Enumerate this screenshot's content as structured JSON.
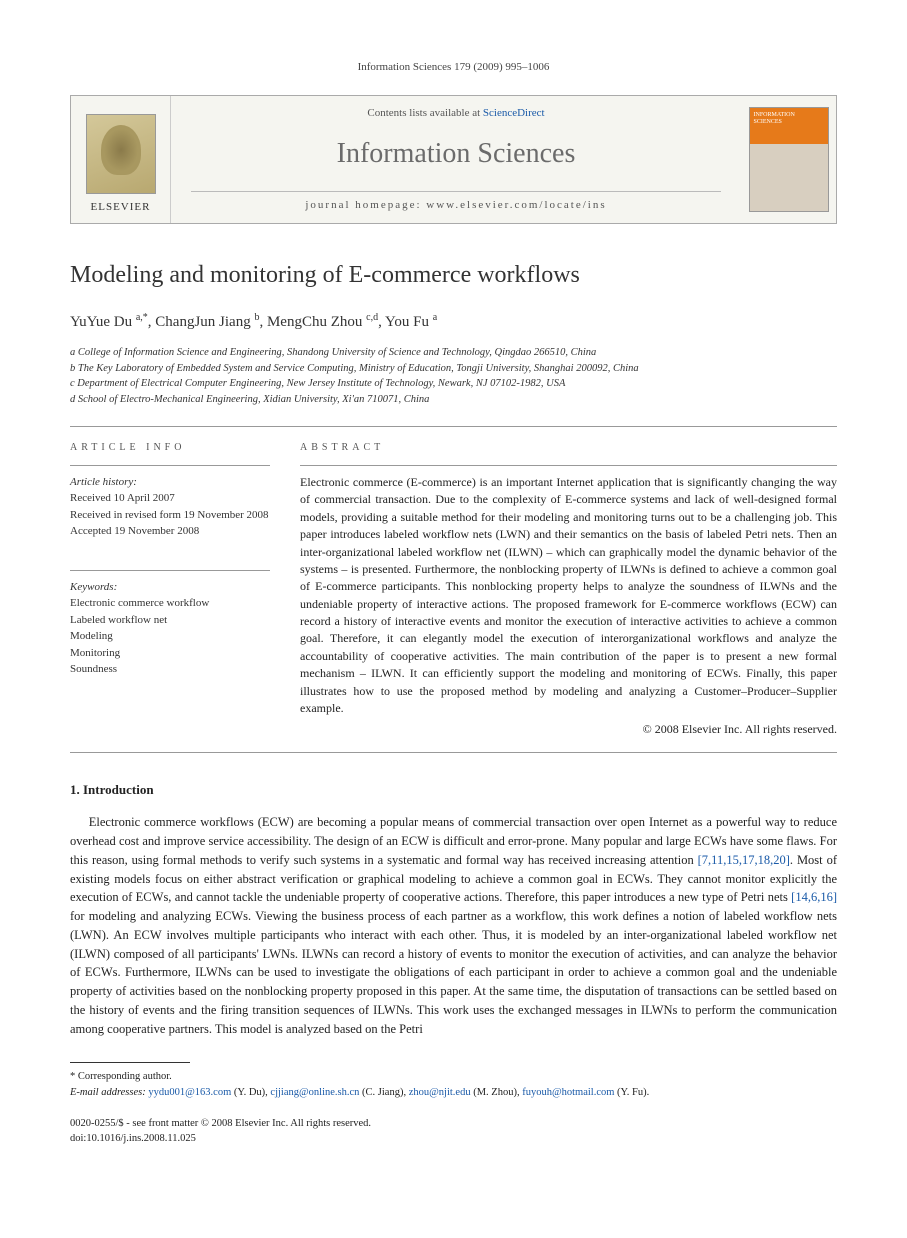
{
  "page_header": "Information Sciences 179 (2009) 995–1006",
  "banner": {
    "contents_text": "Contents lists available at ",
    "contents_link": "ScienceDirect",
    "journal_name": "Information Sciences",
    "homepage_label": "journal homepage: www.elsevier.com/locate/ins",
    "publisher": "ELSEVIER",
    "cover_text": "INFORMATION SCIENCES"
  },
  "article": {
    "title": "Modeling and monitoring of E-commerce workflows",
    "authors_html": "YuYue Du <sup>a,*</sup>, ChangJun Jiang <sup>b</sup>, MengChu Zhou <sup>c,d</sup>, You Fu <sup>a</sup>",
    "affiliations": [
      "a College of Information Science and Engineering, Shandong University of Science and Technology, Qingdao 266510, China",
      "b The Key Laboratory of Embedded System and Service Computing, Ministry of Education, Tongji University, Shanghai 200092, China",
      "c Department of Electrical Computer Engineering, New Jersey Institute of Technology, Newark, NJ 07102-1982, USA",
      "d School of Electro-Mechanical Engineering, Xidian University, Xi'an 710071, China"
    ]
  },
  "article_info": {
    "label": "ARTICLE INFO",
    "history_label": "Article history:",
    "history": [
      "Received 10 April 2007",
      "Received in revised form 19 November 2008",
      "Accepted 19 November 2008"
    ],
    "keywords_label": "Keywords:",
    "keywords": [
      "Electronic commerce workflow",
      "Labeled workflow net",
      "Modeling",
      "Monitoring",
      "Soundness"
    ]
  },
  "abstract": {
    "label": "ABSTRACT",
    "text": "Electronic commerce (E-commerce) is an important Internet application that is significantly changing the way of commercial transaction. Due to the complexity of E-commerce systems and lack of well-designed formal models, providing a suitable method for their modeling and monitoring turns out to be a challenging job. This paper introduces labeled workflow nets (LWN) and their semantics on the basis of labeled Petri nets. Then an inter-organizational labeled workflow net (ILWN) – which can graphically model the dynamic behavior of the systems – is presented. Furthermore, the nonblocking property of ILWNs is defined to achieve a common goal of E-commerce participants. This nonblocking property helps to analyze the soundness of ILWNs and the undeniable property of interactive actions. The proposed framework for E-commerce workflows (ECW) can record a history of interactive events and monitor the execution of interactive activities to achieve a common goal. Therefore, it can elegantly model the execution of interorganizational workflows and analyze the accountability of cooperative activities. The main contribution of the paper is to present a new formal mechanism – ILWN. It can efficiently support the modeling and monitoring of ECWs. Finally, this paper illustrates how to use the proposed method by modeling and analyzing a Customer–Producer–Supplier example.",
    "copyright": "© 2008 Elsevier Inc. All rights reserved."
  },
  "intro": {
    "heading": "1. Introduction",
    "paragraph_pre": "Electronic commerce workflows (ECW) are becoming a popular means of commercial transaction over open Internet as a powerful way to reduce overhead cost and improve service accessibility. The design of an ECW is difficult and error-prone. Many popular and large ECWs have some flaws. For this reason, using formal methods to verify such systems in a systematic and formal way has received increasing attention ",
    "ref1": "[7,11,15,17,18,20]",
    "paragraph_mid": ". Most of existing models focus on either abstract verification or graphical modeling to achieve a common goal in ECWs. They cannot monitor explicitly the execution of ECWs, and cannot tackle the undeniable property of cooperative actions. Therefore, this paper introduces a new type of Petri nets ",
    "ref2": "[14,6,16]",
    "paragraph_post": " for modeling and analyzing ECWs. Viewing the business process of each partner as a workflow, this work defines a notion of labeled workflow nets (LWN). An ECW involves multiple participants who interact with each other. Thus, it is modeled by an inter-organizational labeled workflow net (ILWN) composed of all participants' LWNs. ILWNs can record a history of events to monitor the execution of activities, and can analyze the behavior of ECWs. Furthermore, ILWNs can be used to investigate the obligations of each participant in order to achieve a common goal and the undeniable property of activities based on the nonblocking property proposed in this paper. At the same time, the disputation of transactions can be settled based on the history of events and the firing transition sequences of ILWNs. This work uses the exchanged messages in ILWNs to perform the communication among cooperative partners. This model is analyzed based on the Petri"
  },
  "footnotes": {
    "corresponding": "* Corresponding author.",
    "email_label": "E-mail addresses: ",
    "emails": [
      {
        "addr": "yydu001@163.com",
        "name": " (Y. Du), "
      },
      {
        "addr": "cjjiang@online.sh.cn",
        "name": " (C. Jiang), "
      },
      {
        "addr": "zhou@njit.edu",
        "name": " (M. Zhou), "
      },
      {
        "addr": "fuyouh@hotmail.com",
        "name": " (Y. Fu)."
      }
    ]
  },
  "footer": {
    "line1": "0020-0255/$ - see front matter © 2008 Elsevier Inc. All rights reserved.",
    "line2": "doi:10.1016/j.ins.2008.11.025"
  }
}
